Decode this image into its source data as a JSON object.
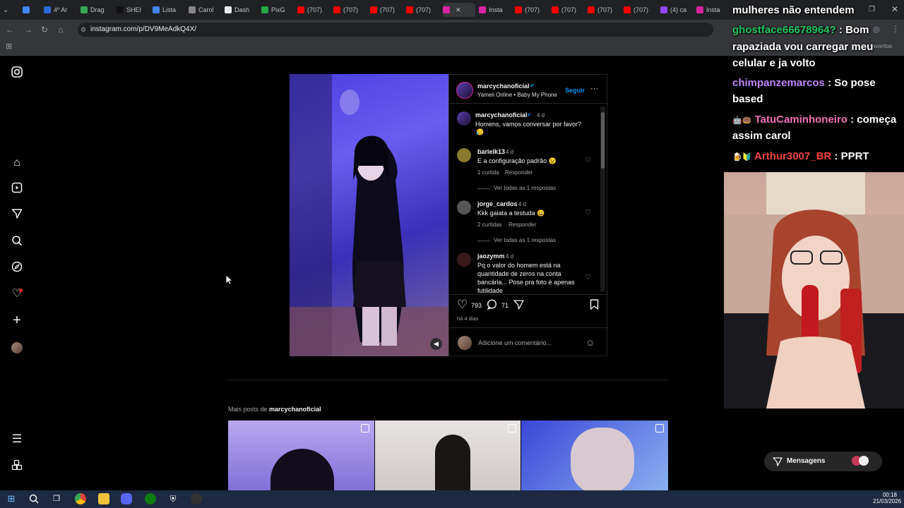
{
  "browser": {
    "tabs": [
      {
        "label": "4º Ar",
        "color": "#2d6ad6"
      },
      {
        "label": "Drag",
        "color": "#34a853"
      },
      {
        "label": "SHEI",
        "color": "#111111"
      },
      {
        "label": "Lista",
        "color": "#4285f4"
      },
      {
        "label": "Carol",
        "color": "#888888"
      },
      {
        "label": "Dash",
        "color": "#e8eaed"
      },
      {
        "label": "PixG",
        "color": "#28a745"
      },
      {
        "label": "(707)",
        "color": "#ff0000"
      },
      {
        "label": "(707)",
        "color": "#ff0000"
      },
      {
        "label": "(707)",
        "color": "#ff0000"
      },
      {
        "label": "(707)",
        "color": "#ff0000"
      },
      {
        "label": "",
        "color": "#d6249f"
      },
      {
        "label": "Insta",
        "color": "#d6249f"
      },
      {
        "label": "(707)",
        "color": "#ff0000"
      },
      {
        "label": "(707)",
        "color": "#ff0000"
      },
      {
        "label": "(707)",
        "color": "#ff0000"
      },
      {
        "label": "(707)",
        "color": "#ff0000"
      },
      {
        "label": "(4) ca",
        "color": "#9146ff"
      },
      {
        "label": "Insta",
        "color": "#d6249f"
      }
    ],
    "url": "instagram.com/p/DV9MeAdkQ4X/",
    "bookmarks_label": "os favoritos"
  },
  "post": {
    "username": "marcychanoficial",
    "follow_label": "Seguir",
    "audio": "Yameii Online • Baby My Phone",
    "caption_user": "marcychanoficial",
    "caption_age": "4 d",
    "caption_text": "Homens, vamos conversar por favor?",
    "comments": [
      {
        "user": "barielk13",
        "age": "4 d",
        "text": "E a configuração padrão 😉",
        "likes": "1 curtida",
        "reply": "Responder",
        "view": "Ver todas as 1 respostas"
      },
      {
        "user": "jorge_cardos",
        "age": "4 d",
        "text": "Kkk gaiata a testuda 😄",
        "likes": "2 curtidas",
        "reply": "Responder",
        "view": "Ver todas as 1 respostas"
      },
      {
        "user": "jaozymm",
        "age": "4 d",
        "text": "Pq o valor do homem está na quantidade de zeros na conta bancária... Pose pra foto é apenas futilidade"
      }
    ],
    "likes_count": "793",
    "comments_count": "71",
    "time_ago": "há 4 dias",
    "comment_placeholder": "Adicione um comentário..."
  },
  "more_posts": {
    "prefix": "Mais posts de",
    "username": "marcychanoficial"
  },
  "messages_label": "Mensagens",
  "stream_chat": [
    {
      "user": "",
      "message": "mulheres não entendem",
      "color": "#ffffff"
    },
    {
      "user": "ghostface66678964?",
      "message": ": Bom",
      "color": "#22c55e"
    },
    {
      "user": "",
      "message": "rapaziada vou carregar meu",
      "color": "#ffffff"
    },
    {
      "user": "",
      "message": "celular e ja volto",
      "color": "#ffffff"
    },
    {
      "user": "chimpanzemarcos",
      "message": ": So pose",
      "color": "#c084fc"
    },
    {
      "user": "",
      "message": "based",
      "color": "#ffffff"
    },
    {
      "user": "TatuCaminhoneiro",
      "message": ": começa",
      "color": "#f472b6"
    },
    {
      "user": "",
      "message": "assim carol",
      "color": "#ffffff"
    },
    {
      "user": "Arthur3007_BR",
      "message": ": PPRT",
      "color": "#ef4444"
    }
  ],
  "taskbar": {
    "time": "00:18",
    "date": "21/03/2026"
  }
}
